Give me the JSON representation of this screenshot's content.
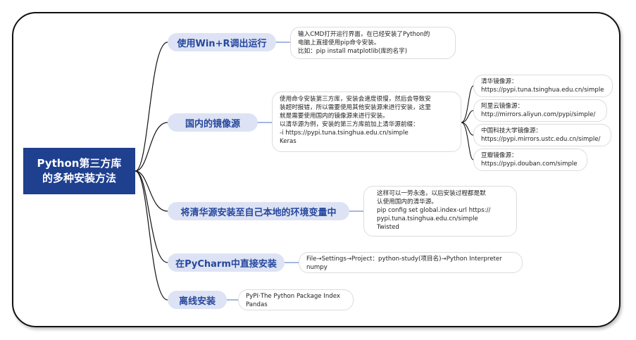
{
  "root": {
    "line1": "Python第三方库",
    "line2": "的多种安装方法"
  },
  "branches": [
    {
      "label": "使用Win+R调出运行",
      "notes": [
        "输入CMD打开运行界面，在已经安装了Python的",
        "电脑上直接使用pip命令安装。",
        "比如：pip install matplotlib(库的名字)"
      ]
    },
    {
      "label": "国内的镜像源",
      "notes": [
        "使用命令安装第三方库，安装会速度很慢，然后会导致安",
        "装超时报错，所以需要使用其他安装源来进行安装，这里",
        "就是需要使用国内的镜像源来进行安装。",
        "以清华源为例，安装的第三方库前加上清华源前缀：",
        "-i https://pypi.tuna.tsinghua.edu.cn/simple",
        "Keras"
      ]
    },
    {
      "label": "将清华源安装至自己本地的环境变量中",
      "notes": [
        "这样可以一劳永逸，以后安装过程都是默",
        "认使用国内的清华源。",
        "pip config set global.index-url https://",
        "pypi.tuna.tsinghua.edu.cn/simple",
        "Twisted"
      ]
    },
    {
      "label": "在PyCharm中直接安装",
      "notes": [
        "File→Settings→Project：python-study(项目名)→Python Interpreter",
        "numpy"
      ]
    },
    {
      "label": "离线安装",
      "notes": [
        "PyPI·The Python Package Index",
        "Pandas"
      ]
    }
  ],
  "mirrors": [
    {
      "name": "清华镜像源：",
      "url": "https://pypi.tuna.tsinghua.edu.cn/simple"
    },
    {
      "name": "阿里云镜像源：",
      "url": "http://mirrors.aliyun.com/pypi/simple/"
    },
    {
      "name": "中国科技大学镜像源：",
      "url": "https://pypi.mirrors.ustc.edu.cn/simple/"
    },
    {
      "name": "豆瓣镜像源：",
      "url": "https://pypi.douban.com/simple"
    }
  ],
  "colors": {
    "root_bg": "#1f3f8f",
    "branch_bg": "#dde3f4",
    "branch_text": "#26479d",
    "connector": "#111111"
  }
}
